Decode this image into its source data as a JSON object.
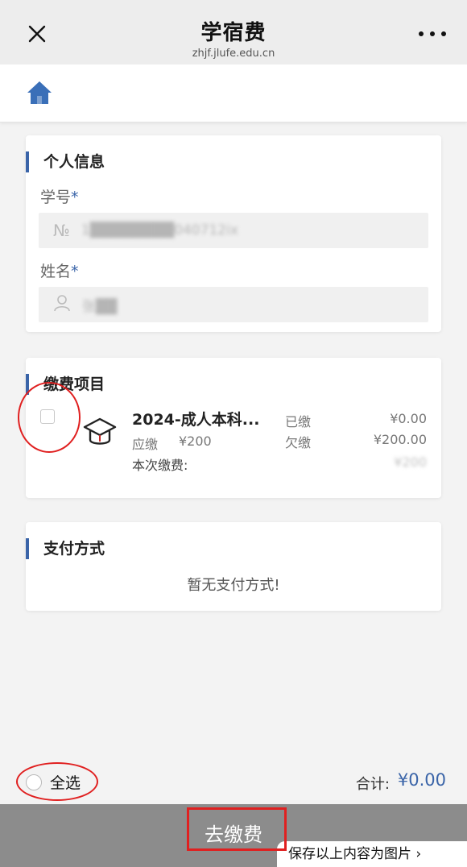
{
  "header": {
    "title": "学宿费",
    "subtitle": "zhjf.jlufe.edu.cn",
    "close_icon": "close-icon",
    "more_icon": "more-dots-icon"
  },
  "home": {
    "icon": "home-icon",
    "color": "#3a6fb8"
  },
  "personal": {
    "title": "个人信息",
    "student_id_label": "学号",
    "required_mark": "*",
    "student_id_value": "1████████040712ix",
    "name_label": "姓名",
    "name_value": "张██"
  },
  "fees": {
    "title": "缴费项目",
    "item_name": "2024-成人本科...",
    "due_label": "应缴",
    "due_value": "¥200",
    "paid_label": "已缴",
    "paid_value": "¥0.00",
    "owed_label": "欠缴",
    "owed_value": "¥200.00",
    "this_payment_label": "本次缴费:",
    "this_payment_value": "¥200"
  },
  "payment": {
    "title": "支付方式",
    "empty_text": "暂无支付方式!"
  },
  "footer": {
    "select_all_label": "全选",
    "total_label": "合计:",
    "total_value": "¥0.00",
    "pay_button_label": "去缴费",
    "save_image_label": "保存以上内容为图片 ›"
  },
  "colors": {
    "accent": "#3a64a8",
    "annotation": "#e02020",
    "pay_bar": "#8c8c8c"
  }
}
